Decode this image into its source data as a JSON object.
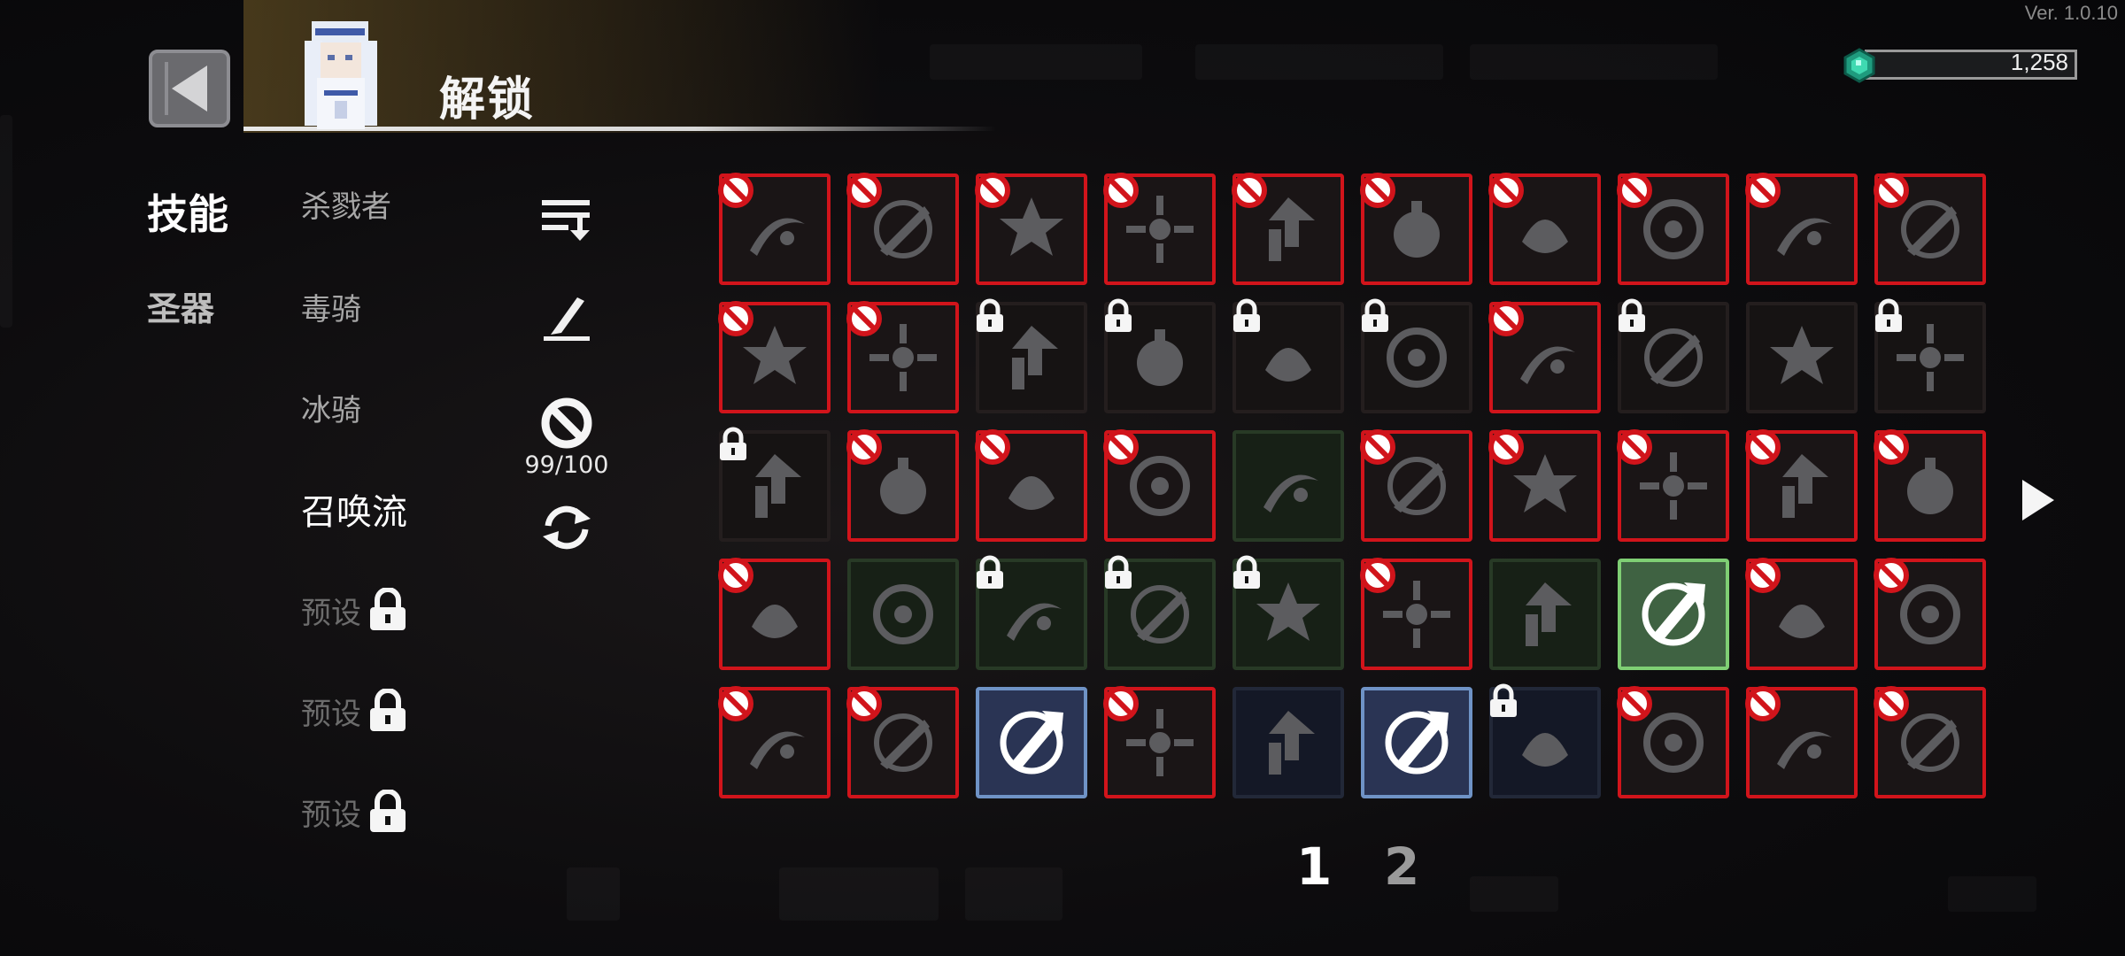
{
  "version": "Ver. 1.0.10",
  "currency": {
    "amount": "1,258",
    "icon": "gem-icon"
  },
  "header": {
    "title": "解锁",
    "back_icon": "back-arrow-icon"
  },
  "categories": [
    {
      "label": "技能",
      "active": true
    },
    {
      "label": "圣器",
      "active": false
    }
  ],
  "builds": [
    {
      "label": "杀戮者",
      "active": false
    },
    {
      "label": "毒骑",
      "active": false
    },
    {
      "label": "冰骑",
      "active": false
    },
    {
      "label": "召唤流",
      "active": true
    }
  ],
  "presets": [
    {
      "label": "预设",
      "locked": true
    },
    {
      "label": "预设",
      "locked": true
    },
    {
      "label": "预设",
      "locked": true
    }
  ],
  "tools": {
    "sort_icon": "sort-icon",
    "edit_icon": "quill-icon",
    "ban_icon": "ban-icon",
    "ban_count": "99/100",
    "reset_icon": "refresh-icon"
  },
  "colors": {
    "banned_border": "#d1141b",
    "selected_blue": "#6f93c6",
    "selected_green": "#7fcf74",
    "green_cell": "#283a26"
  },
  "pagination": {
    "pages": [
      "1",
      "2"
    ],
    "current": "1",
    "next_icon": "next-arrow-icon"
  },
  "skill_grid": [
    [
      {
        "state": "banned",
        "badge": "ban",
        "icon": "crescent-slash-icon"
      },
      {
        "state": "banned",
        "badge": "ban",
        "icon": "curved-blade-icon"
      },
      {
        "state": "banned",
        "badge": "ban",
        "icon": "flame-ring-icon"
      },
      {
        "state": "banned",
        "badge": "ban",
        "icon": "burst-icon"
      },
      {
        "state": "banned",
        "badge": "ban",
        "icon": "hammer-arrow-icon"
      },
      {
        "state": "banned",
        "badge": "ban",
        "icon": "frost-orb-icon"
      },
      {
        "state": "banned",
        "badge": "ban",
        "icon": "fire-orb-icon"
      },
      {
        "state": "banned",
        "badge": "ban",
        "icon": "dark-swirl-icon"
      },
      {
        "state": "banned",
        "badge": "ban",
        "icon": "spears-icon"
      },
      {
        "state": "banned",
        "badge": "ban",
        "icon": "beast-icon"
      }
    ],
    [
      {
        "state": "banned",
        "badge": "ban",
        "icon": "moon-claw-icon"
      },
      {
        "state": "banned",
        "badge": "ban",
        "icon": "shards-icon"
      },
      {
        "state": "lockedD",
        "badge": "lock",
        "icon": "feather-icon"
      },
      {
        "state": "lockedD",
        "badge": "lock",
        "icon": "target-cross-icon"
      },
      {
        "state": "lockedD",
        "badge": "lock",
        "icon": "frost-sword-icon"
      },
      {
        "state": "lockedD",
        "badge": "lock",
        "icon": "vortex-icon"
      },
      {
        "state": "banned",
        "badge": "ban",
        "icon": "radar-icon"
      },
      {
        "state": "lockedD",
        "badge": "lock",
        "icon": "lightning-bolt-icon"
      },
      {
        "state": "lockedD",
        "badge": "none",
        "icon": "spots-icon"
      },
      {
        "state": "lockedD",
        "badge": "lock",
        "icon": "gauntlet-icon"
      }
    ],
    [
      {
        "state": "lockedD",
        "badge": "lock",
        "icon": "eye-swirl-icon"
      },
      {
        "state": "banned",
        "badge": "ban",
        "icon": "ground-slam-icon"
      },
      {
        "state": "banned",
        "badge": "ban",
        "icon": "chain-icon"
      },
      {
        "state": "banned",
        "badge": "ban",
        "icon": "thunder-icon"
      },
      {
        "state": "green",
        "badge": "none",
        "icon": "statue-icon"
      },
      {
        "state": "banned",
        "badge": "ban",
        "icon": "storm-icon"
      },
      {
        "state": "banned",
        "badge": "ban",
        "icon": "skull-icon"
      },
      {
        "state": "banned",
        "badge": "ban",
        "icon": "biohazard-icon"
      },
      {
        "state": "banned",
        "badge": "ban",
        "icon": "lance-icon"
      },
      {
        "state": "banned",
        "badge": "ban",
        "icon": "potion-icon"
      }
    ],
    [
      {
        "state": "banned",
        "badge": "ban",
        "icon": "dragon-head-icon"
      },
      {
        "state": "green",
        "badge": "none",
        "icon": "swords-icon"
      },
      {
        "state": "green",
        "badge": "lock",
        "icon": "winged-orb-icon"
      },
      {
        "state": "green",
        "badge": "lock",
        "icon": "web-icon"
      },
      {
        "state": "green",
        "badge": "lock",
        "icon": "scatter-icon"
      },
      {
        "state": "banned",
        "badge": "ban",
        "icon": "claw-icon"
      },
      {
        "state": "green",
        "badge": "none",
        "icon": "shuriken-icon"
      },
      {
        "state": "sel-green",
        "badge": "none",
        "icon": "gear-sword-icon"
      },
      {
        "state": "banned",
        "badge": "ban",
        "icon": "hex-shield-icon"
      },
      {
        "state": "banned",
        "badge": "ban",
        "icon": "wisp-icon"
      }
    ],
    [
      {
        "state": "banned",
        "badge": "ban",
        "icon": "hourglass-up-icon"
      },
      {
        "state": "banned",
        "badge": "ban",
        "icon": "boot-up-icon"
      },
      {
        "state": "sel-blue",
        "badge": "none",
        "icon": "sword-up-icon"
      },
      {
        "state": "banned",
        "badge": "ban",
        "icon": "tentacle-icon"
      },
      {
        "state": "blue",
        "badge": "none",
        "icon": "bolt-shield-icon"
      },
      {
        "state": "sel-blue",
        "badge": "none",
        "icon": "axe-up-icon"
      },
      {
        "state": "blue",
        "badge": "lock",
        "icon": "spiral-orb-icon"
      },
      {
        "state": "banned",
        "badge": "ban",
        "icon": "fish-icon"
      },
      {
        "state": "banned",
        "badge": "ban",
        "icon": "cloud-beast-icon"
      },
      {
        "state": "banned",
        "badge": "ban",
        "icon": "serpent-icon"
      }
    ]
  ]
}
